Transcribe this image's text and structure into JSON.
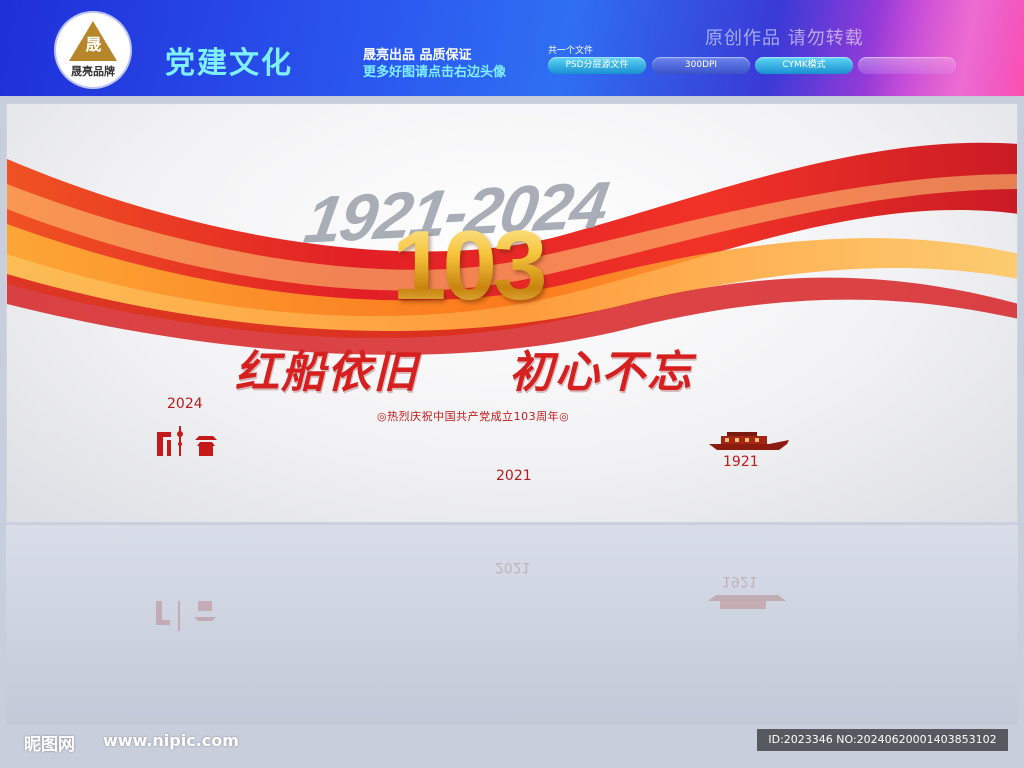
{
  "header": {
    "logo_glyph": "晟",
    "logo_text": "晟亮品牌",
    "brand_title": "党建文化",
    "tagline_line1": "晟亮出品  品质保证",
    "tagline_line2": "更多好图请点击右边头像",
    "file_count": "共一个文件",
    "pills": [
      "PSD分层源文件",
      "300DPI",
      "CYMK模式",
      ""
    ],
    "watermark": "原创作品  请勿转载"
  },
  "artwork": {
    "years_range": "1921-2024",
    "big_number": "103",
    "slogan_left": "红船依旧",
    "slogan_right": "初心不忘",
    "subtitle": "◎热烈庆祝中国共产党成立103周年◎",
    "year_top_left": "2024",
    "year_bottom_center": "2021",
    "year_boat": "1921"
  },
  "footer": {
    "site_name": "昵图网",
    "site_url": "www.nipic.com",
    "id_text": "ID:2023346 NO:20240620001403853102"
  },
  "colors": {
    "header_blue": "#2a55ee",
    "brand_cyan": "#7ff0ff",
    "ribbon_red": "#d61f1f",
    "gold": "#f6c43c"
  }
}
